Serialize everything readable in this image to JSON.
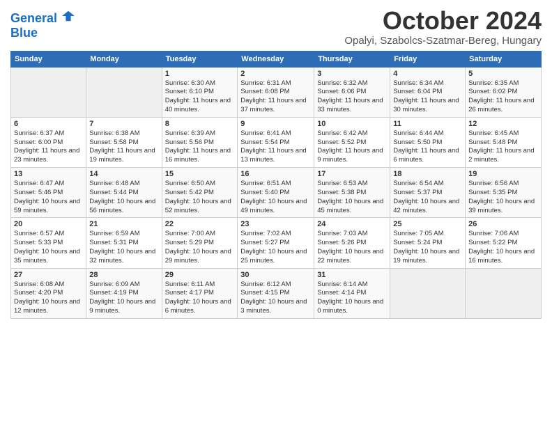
{
  "header": {
    "logo_line1": "General",
    "logo_line2": "Blue",
    "month": "October 2024",
    "location": "Opalyi, Szabolcs-Szatmar-Bereg, Hungary"
  },
  "days_of_week": [
    "Sunday",
    "Monday",
    "Tuesday",
    "Wednesday",
    "Thursday",
    "Friday",
    "Saturday"
  ],
  "weeks": [
    [
      {
        "day": "",
        "info": ""
      },
      {
        "day": "",
        "info": ""
      },
      {
        "day": "1",
        "info": "Sunrise: 6:30 AM\nSunset: 6:10 PM\nDaylight: 11 hours and 40 minutes."
      },
      {
        "day": "2",
        "info": "Sunrise: 6:31 AM\nSunset: 6:08 PM\nDaylight: 11 hours and 37 minutes."
      },
      {
        "day": "3",
        "info": "Sunrise: 6:32 AM\nSunset: 6:06 PM\nDaylight: 11 hours and 33 minutes."
      },
      {
        "day": "4",
        "info": "Sunrise: 6:34 AM\nSunset: 6:04 PM\nDaylight: 11 hours and 30 minutes."
      },
      {
        "day": "5",
        "info": "Sunrise: 6:35 AM\nSunset: 6:02 PM\nDaylight: 11 hours and 26 minutes."
      }
    ],
    [
      {
        "day": "6",
        "info": "Sunrise: 6:37 AM\nSunset: 6:00 PM\nDaylight: 11 hours and 23 minutes."
      },
      {
        "day": "7",
        "info": "Sunrise: 6:38 AM\nSunset: 5:58 PM\nDaylight: 11 hours and 19 minutes."
      },
      {
        "day": "8",
        "info": "Sunrise: 6:39 AM\nSunset: 5:56 PM\nDaylight: 11 hours and 16 minutes."
      },
      {
        "day": "9",
        "info": "Sunrise: 6:41 AM\nSunset: 5:54 PM\nDaylight: 11 hours and 13 minutes."
      },
      {
        "day": "10",
        "info": "Sunrise: 6:42 AM\nSunset: 5:52 PM\nDaylight: 11 hours and 9 minutes."
      },
      {
        "day": "11",
        "info": "Sunrise: 6:44 AM\nSunset: 5:50 PM\nDaylight: 11 hours and 6 minutes."
      },
      {
        "day": "12",
        "info": "Sunrise: 6:45 AM\nSunset: 5:48 PM\nDaylight: 11 hours and 2 minutes."
      }
    ],
    [
      {
        "day": "13",
        "info": "Sunrise: 6:47 AM\nSunset: 5:46 PM\nDaylight: 10 hours and 59 minutes."
      },
      {
        "day": "14",
        "info": "Sunrise: 6:48 AM\nSunset: 5:44 PM\nDaylight: 10 hours and 56 minutes."
      },
      {
        "day": "15",
        "info": "Sunrise: 6:50 AM\nSunset: 5:42 PM\nDaylight: 10 hours and 52 minutes."
      },
      {
        "day": "16",
        "info": "Sunrise: 6:51 AM\nSunset: 5:40 PM\nDaylight: 10 hours and 49 minutes."
      },
      {
        "day": "17",
        "info": "Sunrise: 6:53 AM\nSunset: 5:38 PM\nDaylight: 10 hours and 45 minutes."
      },
      {
        "day": "18",
        "info": "Sunrise: 6:54 AM\nSunset: 5:37 PM\nDaylight: 10 hours and 42 minutes."
      },
      {
        "day": "19",
        "info": "Sunrise: 6:56 AM\nSunset: 5:35 PM\nDaylight: 10 hours and 39 minutes."
      }
    ],
    [
      {
        "day": "20",
        "info": "Sunrise: 6:57 AM\nSunset: 5:33 PM\nDaylight: 10 hours and 35 minutes."
      },
      {
        "day": "21",
        "info": "Sunrise: 6:59 AM\nSunset: 5:31 PM\nDaylight: 10 hours and 32 minutes."
      },
      {
        "day": "22",
        "info": "Sunrise: 7:00 AM\nSunset: 5:29 PM\nDaylight: 10 hours and 29 minutes."
      },
      {
        "day": "23",
        "info": "Sunrise: 7:02 AM\nSunset: 5:27 PM\nDaylight: 10 hours and 25 minutes."
      },
      {
        "day": "24",
        "info": "Sunrise: 7:03 AM\nSunset: 5:26 PM\nDaylight: 10 hours and 22 minutes."
      },
      {
        "day": "25",
        "info": "Sunrise: 7:05 AM\nSunset: 5:24 PM\nDaylight: 10 hours and 19 minutes."
      },
      {
        "day": "26",
        "info": "Sunrise: 7:06 AM\nSunset: 5:22 PM\nDaylight: 10 hours and 16 minutes."
      }
    ],
    [
      {
        "day": "27",
        "info": "Sunrise: 6:08 AM\nSunset: 4:20 PM\nDaylight: 10 hours and 12 minutes."
      },
      {
        "day": "28",
        "info": "Sunrise: 6:09 AM\nSunset: 4:19 PM\nDaylight: 10 hours and 9 minutes."
      },
      {
        "day": "29",
        "info": "Sunrise: 6:11 AM\nSunset: 4:17 PM\nDaylight: 10 hours and 6 minutes."
      },
      {
        "day": "30",
        "info": "Sunrise: 6:12 AM\nSunset: 4:15 PM\nDaylight: 10 hours and 3 minutes."
      },
      {
        "day": "31",
        "info": "Sunrise: 6:14 AM\nSunset: 4:14 PM\nDaylight: 10 hours and 0 minutes."
      },
      {
        "day": "",
        "info": ""
      },
      {
        "day": "",
        "info": ""
      }
    ]
  ]
}
